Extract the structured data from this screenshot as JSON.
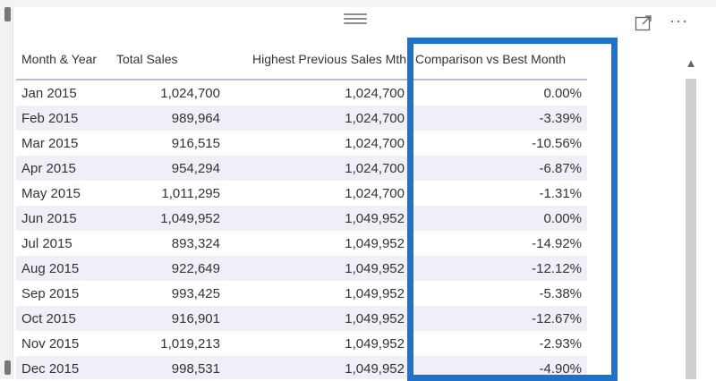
{
  "table": {
    "columns": [
      "Month & Year",
      "Total Sales",
      "Highest Previous Sales Mth",
      "Comparison vs Best Month"
    ],
    "rows": [
      [
        "Jan 2015",
        "1,024,700",
        "1,024,700",
        "0.00%"
      ],
      [
        "Feb 2015",
        "989,964",
        "1,024,700",
        "-3.39%"
      ],
      [
        "Mar 2015",
        "916,515",
        "1,024,700",
        "-10.56%"
      ],
      [
        "Apr 2015",
        "954,294",
        "1,024,700",
        "-6.87%"
      ],
      [
        "May 2015",
        "1,011,295",
        "1,024,700",
        "-1.31%"
      ],
      [
        "Jun 2015",
        "1,049,952",
        "1,049,952",
        "0.00%"
      ],
      [
        "Jul 2015",
        "893,324",
        "1,049,952",
        "-14.92%"
      ],
      [
        "Aug 2015",
        "922,649",
        "1,049,952",
        "-12.12%"
      ],
      [
        "Sep 2015",
        "993,425",
        "1,049,952",
        "-5.38%"
      ],
      [
        "Oct 2015",
        "916,901",
        "1,049,952",
        "-12.67%"
      ],
      [
        "Nov 2015",
        "1,019,213",
        "1,049,952",
        "-2.93%"
      ],
      [
        "Dec 2015",
        "998,531",
        "1,049,952",
        "-4.90%"
      ]
    ]
  },
  "toolbar": {
    "more_options_label": "···",
    "focus_icon": "focus-mode-icon",
    "drag_icon": "drag-handle-icon"
  },
  "scrollbar": {
    "up_arrow": "▲"
  },
  "colors": {
    "highlight": "#1f72c9",
    "row_alt": "#eff0f7",
    "header_rule": "#aebfd6"
  }
}
